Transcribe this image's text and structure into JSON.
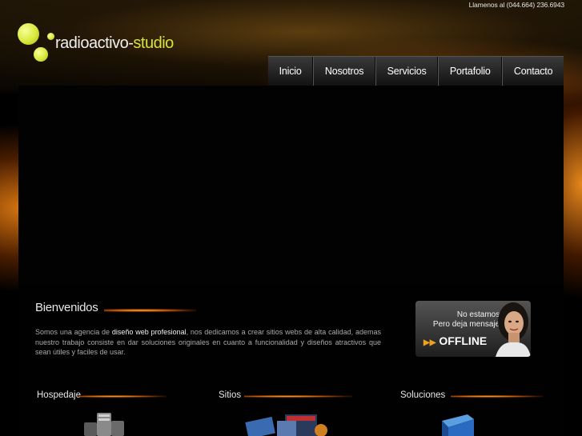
{
  "header": {
    "phone": "Llamenos al (044.664) 236.6943",
    "logo_text_main": "radioactivo-",
    "logo_text_accent": "studio"
  },
  "nav": {
    "items": [
      {
        "label": "Inicio"
      },
      {
        "label": "Nosotros"
      },
      {
        "label": "Servicios"
      },
      {
        "label": "Portafolio"
      },
      {
        "label": "Contacto"
      }
    ]
  },
  "welcome": {
    "title": "Bienvenidos",
    "text_before": "Somos una agencia de ",
    "text_highlight": "diseño web profesional",
    "text_after": ", nos dedicamos a crear sitios webs de alta calidad, ademas nuestro trabajo consiste en dar soluciones originales en cuanto a funcionalidad y diseños atractivos que sean útiles y faciles de usar."
  },
  "chat": {
    "line1": "No estamos.",
    "line2": "Pero deja mensaje!",
    "status": "OFFLINE"
  },
  "services": [
    {
      "title": "Hospedaje"
    },
    {
      "title": "Sitios"
    },
    {
      "title": "Soluciones"
    }
  ],
  "colors": {
    "accent_yellow": "#d6e33a",
    "accent_orange": "#f0a020",
    "text_gray": "#a9a9a9"
  }
}
